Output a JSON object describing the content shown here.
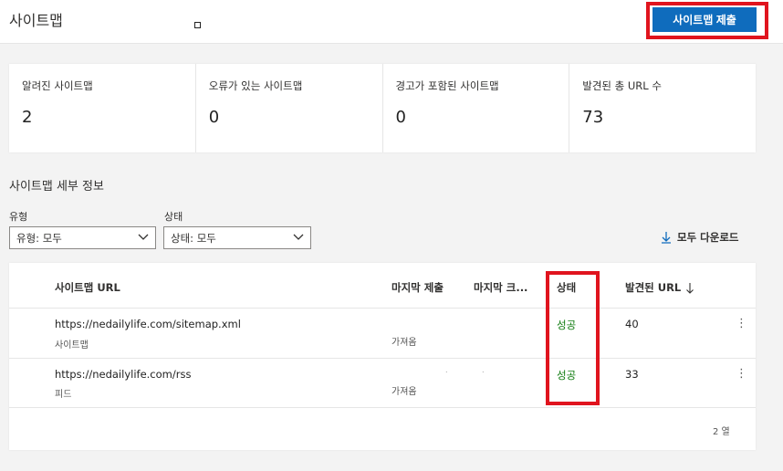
{
  "header": {
    "title": "사이트맵",
    "submit_button": "사이트맵 제출"
  },
  "stats": [
    {
      "label": "알려진 사이트맵",
      "value": "2"
    },
    {
      "label": "오류가 있는 사이트맵",
      "value": "0"
    },
    {
      "label": "경고가 포함된 사이트맵",
      "value": "0"
    },
    {
      "label": "발견된 총 URL 수",
      "value": "73"
    }
  ],
  "details": {
    "title": "사이트맵 세부 정보",
    "filters": {
      "type_label": "유형",
      "type_value": "유형: 모두",
      "status_label": "상태",
      "status_value": "상태: 모두"
    },
    "download_label": "모두 다운로드"
  },
  "table": {
    "columns": {
      "url": "사이트맵 URL",
      "last_submitted": "마지막 제출",
      "last_crawled": "마지막 크...",
      "status": "상태",
      "discovered": "발견된 URL"
    },
    "rows": [
      {
        "url": "https://nedailylife.com/sitemap.xml",
        "type": "사이트맵",
        "last_crawled": "가져옴",
        "status": "성공",
        "discovered": "40"
      },
      {
        "url": "https://nedailylife.com/rss",
        "type": "피드",
        "last_crawled": "가져옴",
        "status": "성공",
        "discovered": "33"
      }
    ],
    "row_count": "2 열"
  },
  "colors": {
    "accent": "#0f6cbd",
    "success": "#107c10",
    "highlight": "#e0141e"
  }
}
